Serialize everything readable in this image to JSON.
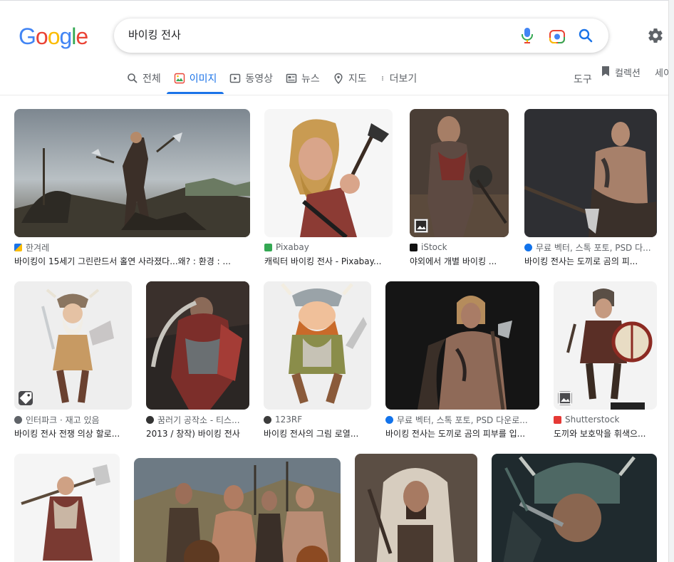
{
  "logo": {
    "letters": [
      "G",
      "o",
      "o",
      "g",
      "l",
      "e"
    ],
    "colors": [
      "#4285F4",
      "#EA4335",
      "#FBBC05",
      "#4285F4",
      "#34A853",
      "#EA4335"
    ]
  },
  "search": {
    "value": "바이킹 전사"
  },
  "tabs": [
    {
      "label": "전체",
      "icon": "search-icon"
    },
    {
      "label": "이미지",
      "icon": "image-icon",
      "active": true
    },
    {
      "label": "동영상",
      "icon": "video-icon"
    },
    {
      "label": "뉴스",
      "icon": "news-icon"
    },
    {
      "label": "지도",
      "icon": "map-pin-icon"
    },
    {
      "label": "더보기",
      "icon": "more-vert-icon"
    }
  ],
  "toolbar": {
    "tools": "도구",
    "collections": "컬렉션",
    "safesearch": "세이"
  },
  "accent": "#1a73e8",
  "results": [
    {
      "source": "한겨레",
      "title": "바이킹이 15세기 그린란드서 홀연 사라졌다...왜? : 환경 : ..."
    },
    {
      "source": "Pixabay",
      "title": "캐릭터 바이킹 전사 - Pixabay..."
    },
    {
      "source": "iStock",
      "title": "야외에서 개별 바이킹 ..."
    },
    {
      "source": "무료 벡터, 스톡 포토, PSD 다...",
      "title": "바이킹 전사는 도끼로 곰의 피..."
    },
    {
      "source": "인터파크 · 재고 있음",
      "title": "바이킹 전사 전쟁 의상 할로..."
    },
    {
      "source": "꿈러기 공작소 - 티스...",
      "title": "2013 / 창작) 바이킹 전사"
    },
    {
      "source": "123RF",
      "title": "바이킹 전사의 그림 로열..."
    },
    {
      "source": "무료 벡터, 스톡 포토, PSD 다운로...",
      "title": "바이킹 전사는 도끼로 곰의 피부를 입..."
    },
    {
      "source": "Shutterstock",
      "title": "도끼와 보호막을 휘색으..."
    }
  ]
}
